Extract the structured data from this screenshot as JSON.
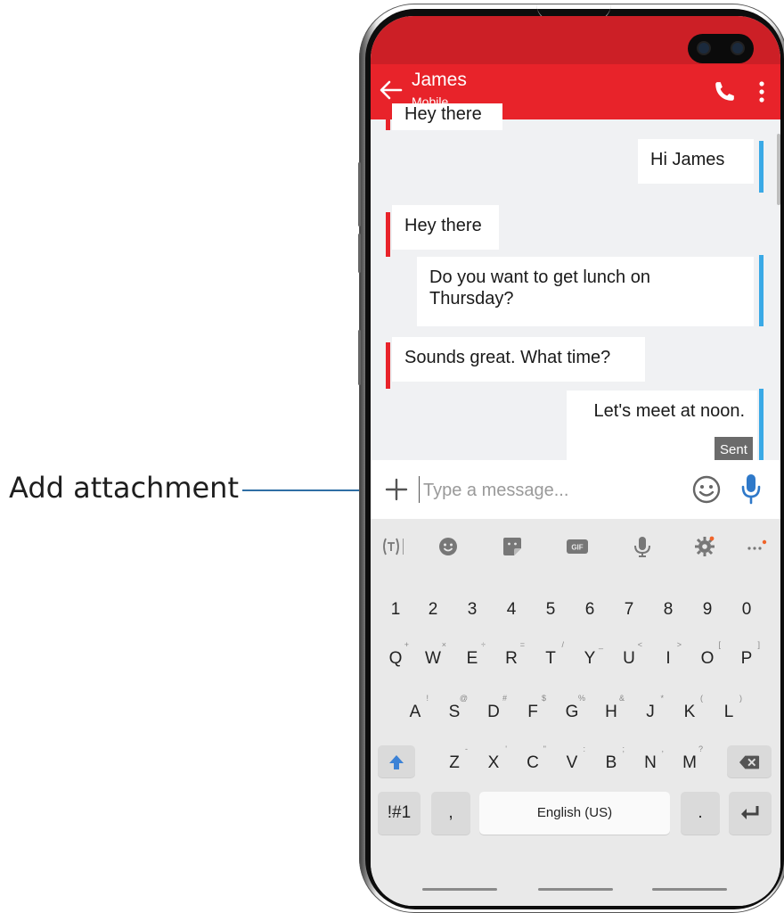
{
  "callout": {
    "label": "Add attachment"
  },
  "header": {
    "contact_name": "James",
    "contact_subtitle": "Mobile",
    "brand_color": "#e8232a"
  },
  "conversation": {
    "partial_top": "Hey there",
    "messages": [
      {
        "direction": "outgoing",
        "text": "Hi James"
      },
      {
        "direction": "incoming",
        "text": "Hey there"
      },
      {
        "direction": "outgoing",
        "text": "Do you want to get lunch on Thursday?"
      },
      {
        "direction": "incoming",
        "text": "Sounds great. What time?"
      },
      {
        "direction": "outgoing",
        "text": "Let's meet at noon.",
        "status": "Sent"
      }
    ]
  },
  "composer": {
    "placeholder": "Type a message...",
    "icons": [
      "plus-icon",
      "emoji-icon",
      "microphone-icon"
    ]
  },
  "keyboard": {
    "toolbar_icons": [
      "text-translate-icon",
      "emoji-icon",
      "sticker-icon",
      "gif-icon",
      "microphone-icon",
      "settings-icon",
      "more-icon"
    ],
    "gif_label": "GIF",
    "number_row": [
      "1",
      "2",
      "3",
      "4",
      "5",
      "6",
      "7",
      "8",
      "9",
      "0"
    ],
    "row1": [
      "Q",
      "W",
      "E",
      "R",
      "T",
      "Y",
      "U",
      "I",
      "O",
      "P"
    ],
    "row1_hints": [
      "+",
      "×",
      "÷",
      "=",
      "/",
      "_",
      "<",
      ">",
      "[",
      "]"
    ],
    "row2": [
      "A",
      "S",
      "D",
      "F",
      "G",
      "H",
      "J",
      "K",
      "L"
    ],
    "row2_hints": [
      "!",
      "@",
      "#",
      "$",
      "%",
      "&",
      "*",
      "(",
      ")"
    ],
    "row3": [
      "Z",
      "X",
      "C",
      "V",
      "B",
      "N",
      "M"
    ],
    "row3_hints": [
      "-",
      "'",
      "\"",
      ":",
      ";",
      ",",
      "?"
    ],
    "symbols_key": "!#1",
    "comma_key": ",",
    "space_key": "English (US)",
    "period_key": ".",
    "shift_color": "#3c82d6"
  }
}
